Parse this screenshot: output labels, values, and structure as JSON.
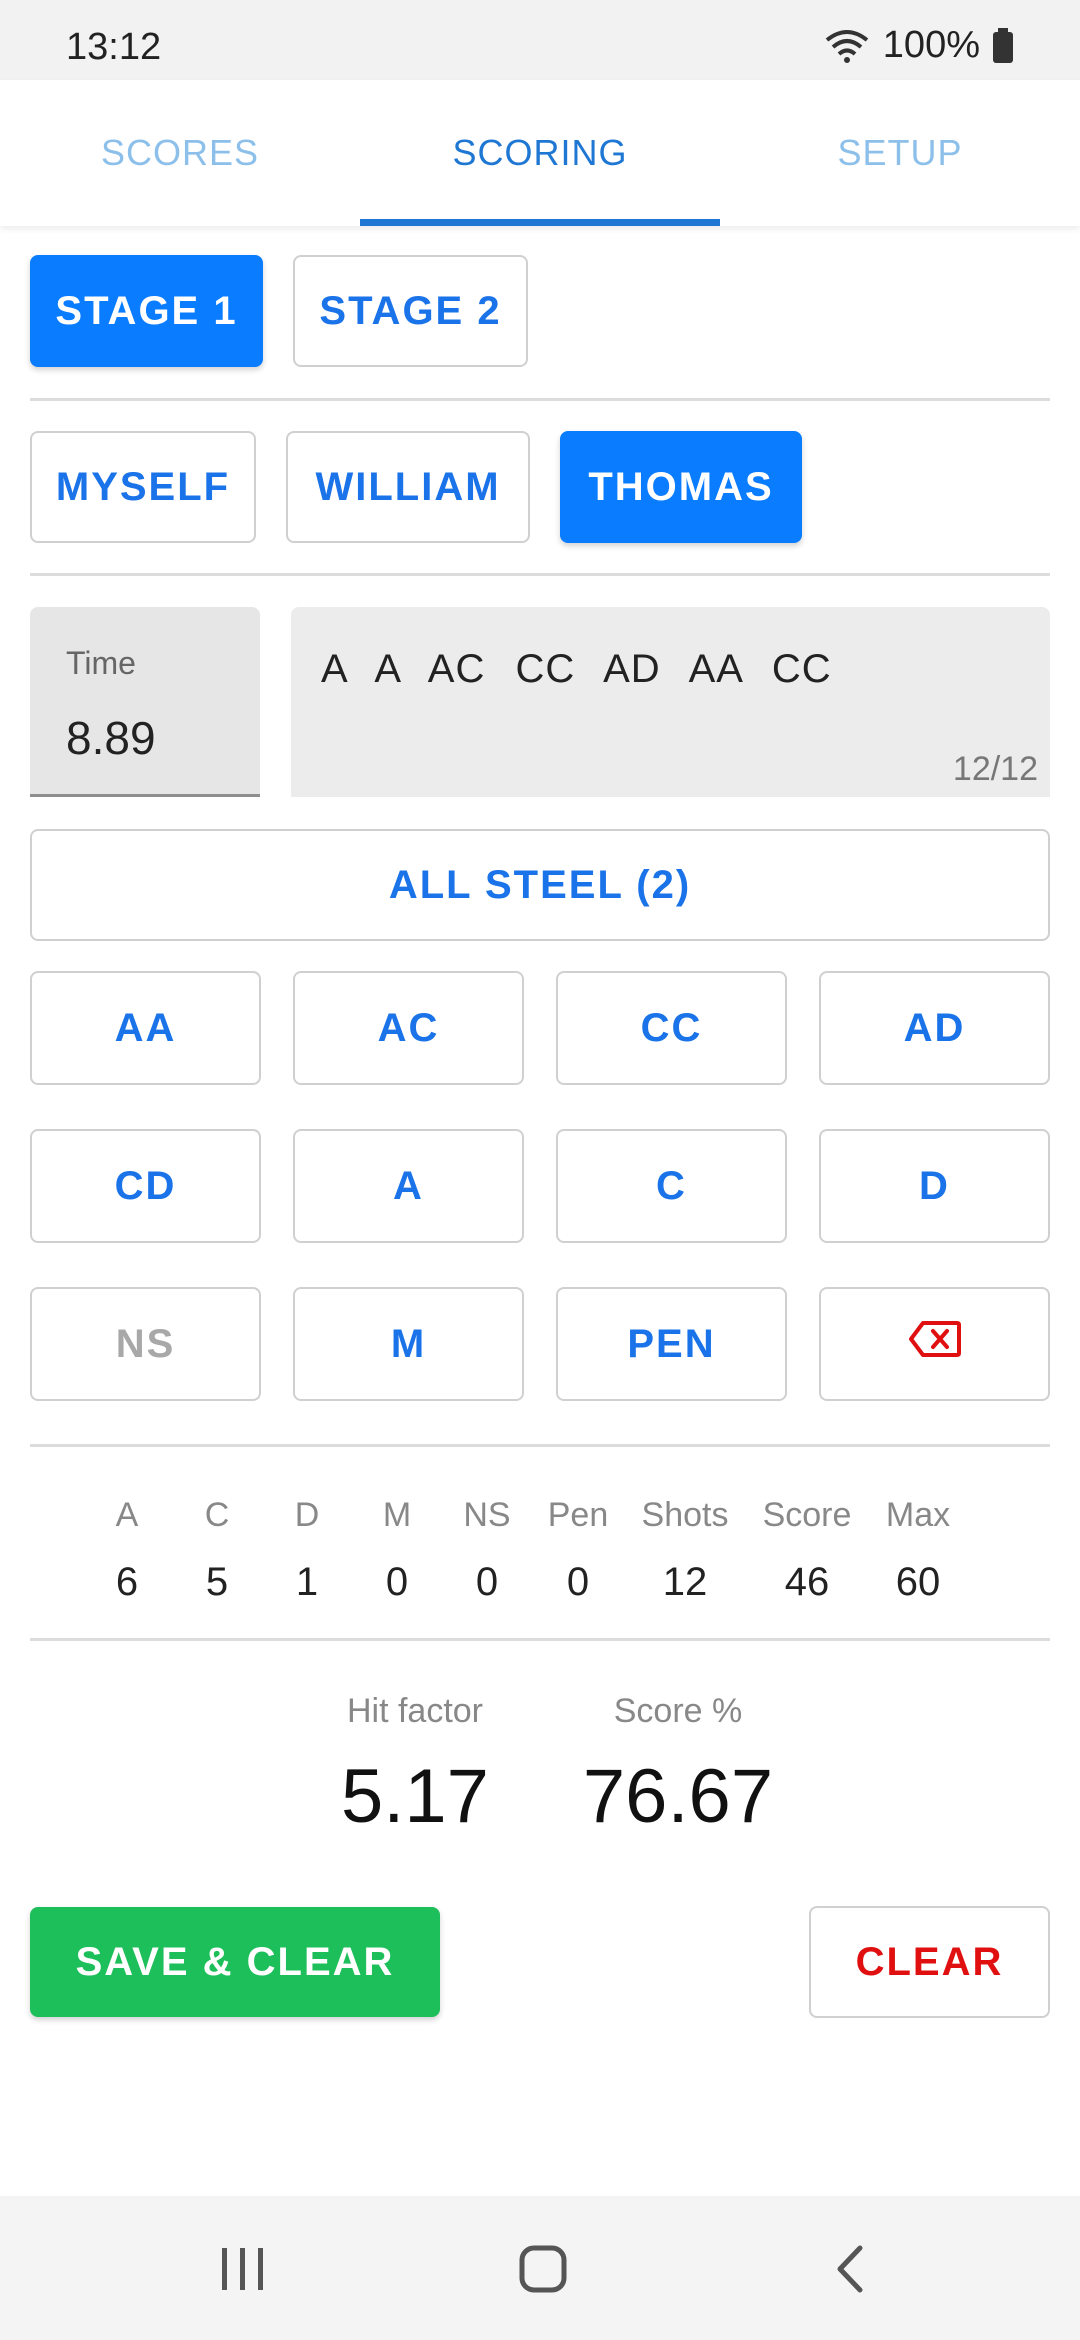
{
  "status_bar": {
    "time": "13:12",
    "battery": "100%",
    "icons": [
      "wifi-icon",
      "battery-icon"
    ]
  },
  "tabs": [
    {
      "label": "SCORES",
      "active": false
    },
    {
      "label": "SCORING",
      "active": true
    },
    {
      "label": "SETUP",
      "active": false
    }
  ],
  "stages": [
    {
      "label": "STAGE 1",
      "selected": true
    },
    {
      "label": "STAGE 2",
      "selected": false
    }
  ],
  "shooters": [
    {
      "label": "MYSELF",
      "selected": false
    },
    {
      "label": "WILLIAM",
      "selected": false
    },
    {
      "label": "THOMAS",
      "selected": true
    }
  ],
  "time_field": {
    "label": "Time",
    "value": "8.89"
  },
  "shots_field": {
    "value": "A  A  AC  CC  AD  AA  CC",
    "counter": "12/12"
  },
  "all_steel_label": "ALL STEEL (2)",
  "keypad": {
    "row1": [
      "AA",
      "AC",
      "CC",
      "AD"
    ],
    "row2": [
      "CD",
      "A",
      "C",
      "D"
    ],
    "row3": [
      "NS",
      "M",
      "PEN"
    ],
    "backspace_icon": "backspace-icon"
  },
  "stats": {
    "labels": [
      "A",
      "C",
      "D",
      "M",
      "NS",
      "Pen",
      "Shots",
      "Score",
      "Max"
    ],
    "values": [
      "6",
      "5",
      "1",
      "0",
      "0",
      "0",
      "12",
      "46",
      "60"
    ]
  },
  "results": {
    "hit_factor_label": "Hit factor",
    "hit_factor_value": "5.17",
    "score_pct_label": "Score %",
    "score_pct_value": "76.67"
  },
  "actions": {
    "save_clear_label": "SAVE & CLEAR",
    "clear_label": "CLEAR"
  },
  "colors": {
    "accent": "#0a7cff",
    "tab_active": "#1f77d4",
    "save": "#1dbf5a",
    "clear": "#e01010"
  },
  "nav_icons": [
    "recent-apps-icon",
    "home-icon",
    "back-icon"
  ]
}
